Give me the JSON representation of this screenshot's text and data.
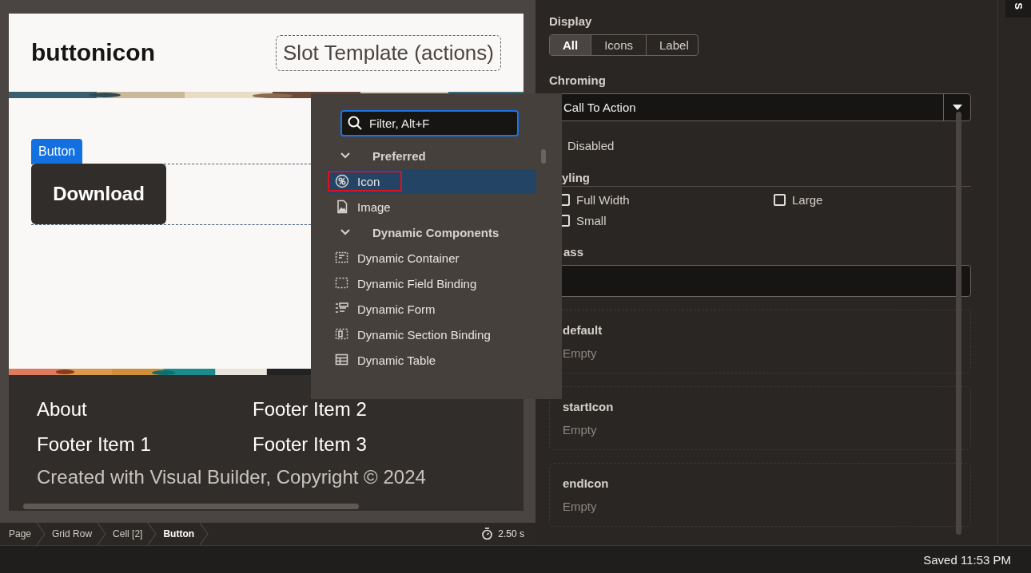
{
  "page_preview": {
    "title": "buttonicon",
    "slot_label": "Slot Template (actions)",
    "component_tag": "Button",
    "button_label": "Download",
    "footer_links": [
      "About",
      "Footer Item 2",
      "Footer Item 1",
      "Footer Item 3"
    ],
    "copyright": "Created with Visual Builder, Copyright © 2024"
  },
  "breadcrumbs": [
    {
      "label": "Page",
      "selected": false
    },
    {
      "label": "Grid Row",
      "selected": false
    },
    {
      "label": "Cell [2]",
      "selected": false
    },
    {
      "label": "Button",
      "selected": true
    }
  ],
  "timer": "2.50 s",
  "properties": {
    "display": {
      "label": "Display",
      "options": [
        {
          "label": "All",
          "selected": true
        },
        {
          "label": "Icons",
          "selected": false
        },
        {
          "label": "Label",
          "selected": false
        }
      ]
    },
    "chroming": {
      "label": "Chroming",
      "value": "Call To Action"
    },
    "disabled_label": "Disabled",
    "styling": {
      "label": "yling",
      "options": [
        {
          "label": "Full Width",
          "checked": false
        },
        {
          "label": "Large",
          "checked": false
        },
        {
          "label": "Small",
          "checked": false
        }
      ]
    },
    "class_label": "ass",
    "slots": [
      {
        "name": "default",
        "content": "Empty"
      },
      {
        "name": "startIcon",
        "content": "Empty"
      },
      {
        "name": "endIcon",
        "content": "Empty"
      }
    ]
  },
  "side_tab": "S",
  "palette": {
    "filter_placeholder": "Filter, Alt+F",
    "groups": [
      {
        "label": "Preferred",
        "expanded": true,
        "items": [
          {
            "label": "Icon",
            "selected": true
          },
          {
            "label": "Image",
            "selected": false
          }
        ]
      },
      {
        "label": "Dynamic Components",
        "expanded": true,
        "items": [
          {
            "label": "Dynamic Container",
            "selected": false
          },
          {
            "label": "Dynamic Field Binding",
            "selected": false
          },
          {
            "label": "Dynamic Form",
            "selected": false
          },
          {
            "label": "Dynamic Section Binding",
            "selected": false
          },
          {
            "label": "Dynamic Table",
            "selected": false
          }
        ]
      }
    ]
  },
  "status": "Saved 11:53 PM"
}
